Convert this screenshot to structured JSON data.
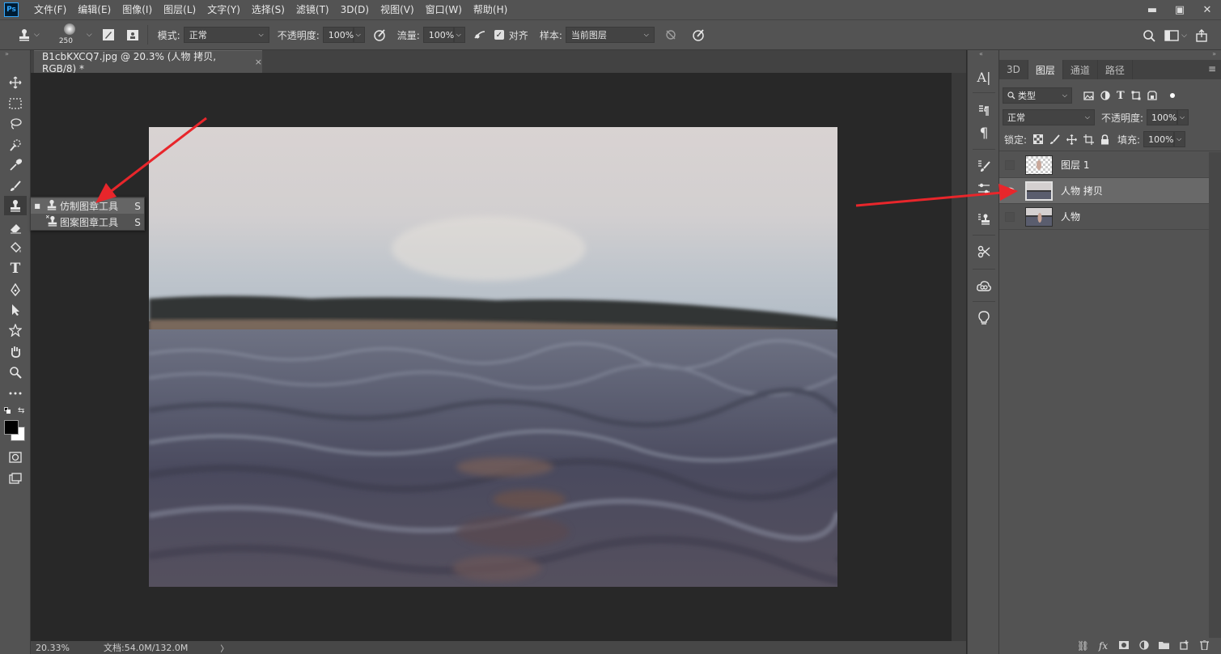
{
  "app": {
    "logo": "Ps"
  },
  "menu": [
    "文件(F)",
    "编辑(E)",
    "图像(I)",
    "图层(L)",
    "文字(Y)",
    "选择(S)",
    "滤镜(T)",
    "3D(D)",
    "视图(V)",
    "窗口(W)",
    "帮助(H)"
  ],
  "window_controls": {
    "minimize": "▬",
    "restore": "▣",
    "close": "✕"
  },
  "options": {
    "brush_size": "250",
    "mode_label": "模式:",
    "mode_value": "正常",
    "opacity_label": "不透明度:",
    "opacity_value": "100%",
    "flow_label": "流量:",
    "flow_value": "100%",
    "aligned_label": "对齐",
    "aligned_checked": true,
    "sample_label": "样本:",
    "sample_value": "当前图层"
  },
  "document": {
    "tab_title": "B1cbKXCQ7.jpg @ 20.3% (人物 拷贝, RGB/8) *",
    "close_glyph": "×",
    "zoom": "20.33%",
    "doc_size": "文档:54.0M/132.0M",
    "status_arrow": "〉"
  },
  "tool_flyout": {
    "items": [
      {
        "label": "仿制图章工具",
        "shortcut": "S",
        "selected": true
      },
      {
        "label": "图案图章工具",
        "shortcut": "S",
        "selected": false
      }
    ]
  },
  "layers_panel": {
    "tabs": [
      "3D",
      "图层",
      "通道",
      "路径"
    ],
    "active_tab": "图层",
    "filter_label": "类型",
    "blend_mode": "正常",
    "opacity_label": "不透明度:",
    "opacity_value": "100%",
    "lock_label": "锁定:",
    "fill_label": "填充:",
    "fill_value": "100%",
    "layers": [
      {
        "name": "图层 1",
        "visible": false,
        "selected": false
      },
      {
        "name": "人物 拷贝",
        "visible": true,
        "selected": true
      },
      {
        "name": "人物",
        "visible": false,
        "selected": false
      }
    ]
  },
  "colors": {
    "arrow": "#e8262b",
    "panel_bg": "#535353",
    "canvas_bg": "#282828"
  }
}
